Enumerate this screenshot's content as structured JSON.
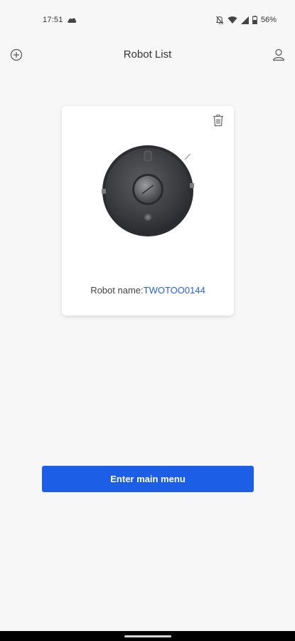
{
  "status_bar": {
    "time": "17:51",
    "battery_percent": "56%"
  },
  "header": {
    "title": "Robot List"
  },
  "robot_card": {
    "name_label": "Robot name:",
    "name_value": "TWOTOO0144"
  },
  "actions": {
    "enter_main_menu_label": "Enter main menu"
  },
  "colors": {
    "accent": "#1c5fe6",
    "link": "#2a63d6",
    "background": "#f7f7f7"
  }
}
